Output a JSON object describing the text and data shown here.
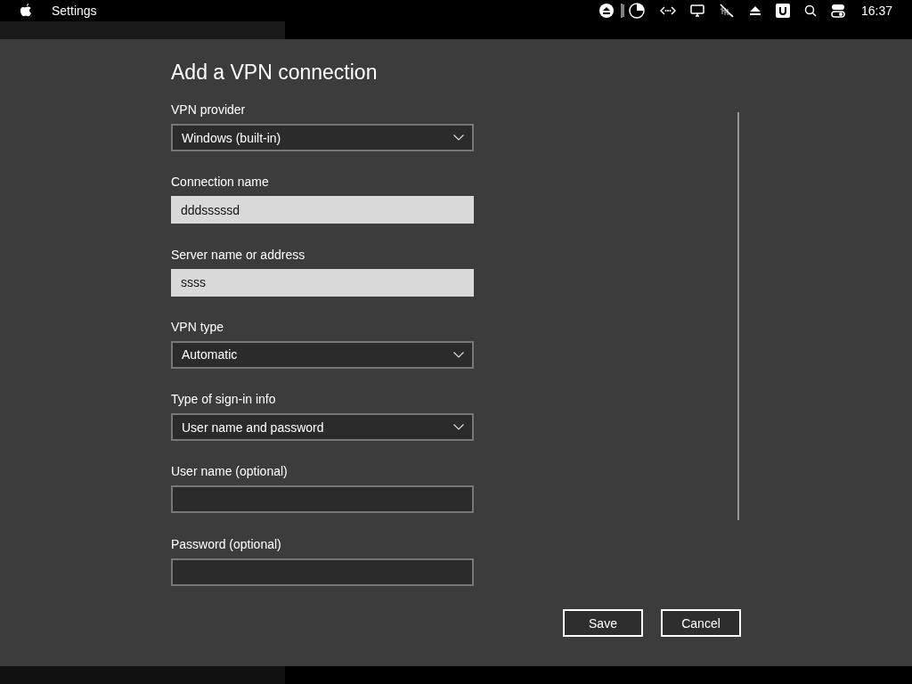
{
  "menu_bar": {
    "app_name": "Settings",
    "clock": "16:37"
  },
  "dialog": {
    "title": "Add a VPN connection",
    "fields": [
      {
        "label": "VPN provider",
        "kind": "dropdown",
        "value": "Windows (built-in)"
      },
      {
        "label": "Connection name",
        "kind": "text",
        "value": "dddsssssd"
      },
      {
        "label": "Server name or address",
        "kind": "text",
        "value": "ssss"
      },
      {
        "label": "VPN type",
        "kind": "dropdown",
        "value": "Automatic"
      },
      {
        "label": "Type of sign-in info",
        "kind": "dropdown",
        "value": "User name and password"
      },
      {
        "label": "User name (optional)",
        "kind": "text"
      },
      {
        "label": "Password (optional)",
        "kind": "text"
      }
    ],
    "buttons": [
      "Save",
      "Cancel"
    ]
  }
}
